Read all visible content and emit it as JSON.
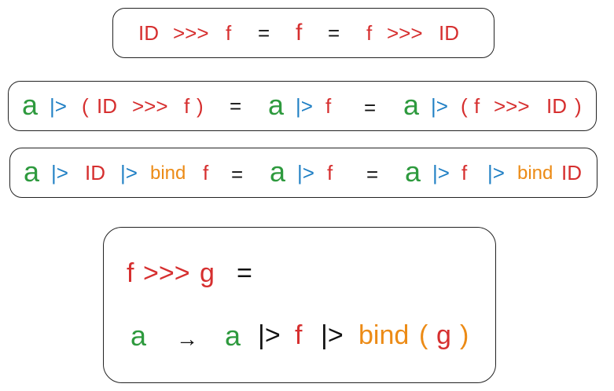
{
  "colors": {
    "id_fn": "#d62f2f",
    "value": "#2e9a3e",
    "pipe": "#1f7fc4",
    "bind": "#ec8b16",
    "operator": "#111111"
  },
  "identity_law": {
    "tokens": [
      "ID",
      ">>>",
      "f",
      "=",
      "f",
      "=",
      "f",
      ">>>",
      "ID"
    ]
  },
  "compose_pipe_law": {
    "tokens": [
      "a",
      "|>",
      "(",
      "ID",
      ">>>",
      "f",
      ")",
      "=",
      "a",
      "|>",
      "f",
      "=",
      "a",
      "|>",
      "(",
      "f",
      ">>>",
      "ID",
      ")"
    ]
  },
  "bind_law": {
    "tokens": [
      "a",
      "|>",
      "ID",
      "|>",
      "bind",
      "f",
      "=",
      "a",
      "|>",
      "f",
      "=",
      "a",
      "|>",
      "f",
      "|>",
      "bind",
      "ID"
    ]
  },
  "composition_definition": {
    "line1": [
      "f",
      ">>>",
      "g",
      "="
    ],
    "line2": [
      "a",
      "→",
      "a",
      "|>",
      "f",
      "|>",
      "bind",
      "(",
      "g",
      ")"
    ]
  }
}
